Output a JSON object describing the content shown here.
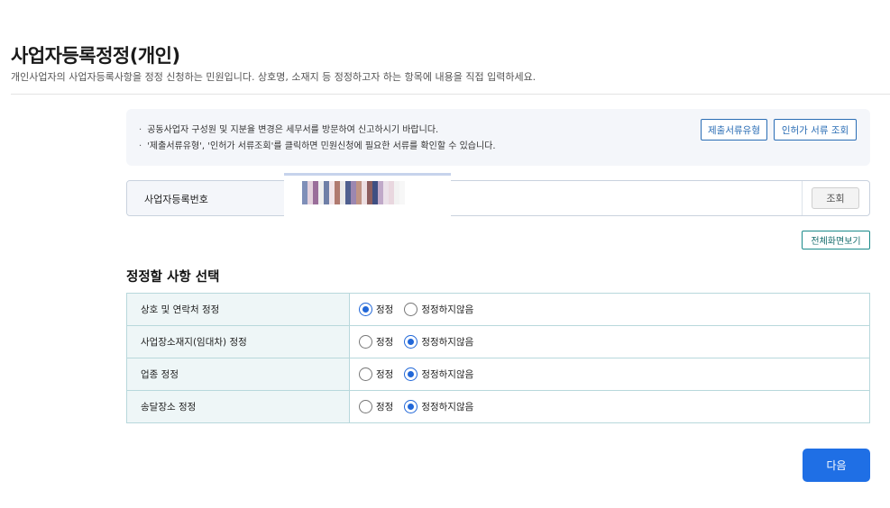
{
  "header": {
    "title": "사업자등록정정(개인)",
    "description": "개인사업자의 사업자등록사항을 정정 신청하는 민원입니다. 상호명, 소재지 등 정정하고자 하는 항목에 내용을 직접 입력하세요."
  },
  "notice": {
    "items": [
      "공동사업자 구성원 및 지분율 변경은 세무서를 방문하여 신고하시기 바랍니다.",
      "'제출서류유형', '인허가 서류조회'를 클릭하면 민원신청에 필요한 서류를 확인할 수 있습니다."
    ],
    "docs_button": "제출서류유형",
    "permit_button": "인허가 서류 조회"
  },
  "registration": {
    "label": "사업자등록번호",
    "lookup_button": "조회"
  },
  "fullview_button": "전체화면보기",
  "section_title": "정정할 사항 선택",
  "options": [
    {
      "label": "상호 및 연락처 정정",
      "opt_yes": "정정",
      "opt_no": "정정하지않음",
      "selected": "yes"
    },
    {
      "label": "사업장소재지(임대차) 정정",
      "opt_yes": "정정",
      "opt_no": "정정하지않음",
      "selected": "no"
    },
    {
      "label": "업종 정정",
      "opt_yes": "정정",
      "opt_no": "정정하지않음",
      "selected": "no"
    },
    {
      "label": "송달장소 정정",
      "opt_yes": "정정",
      "opt_no": "정정하지않음",
      "selected": "no"
    }
  ],
  "next_button": "다음",
  "colors": {
    "primary": "#1f6fe5",
    "outline": "#2a6db5",
    "teal": "#1a8a8a",
    "table_label_bg": "#eef6f7"
  }
}
